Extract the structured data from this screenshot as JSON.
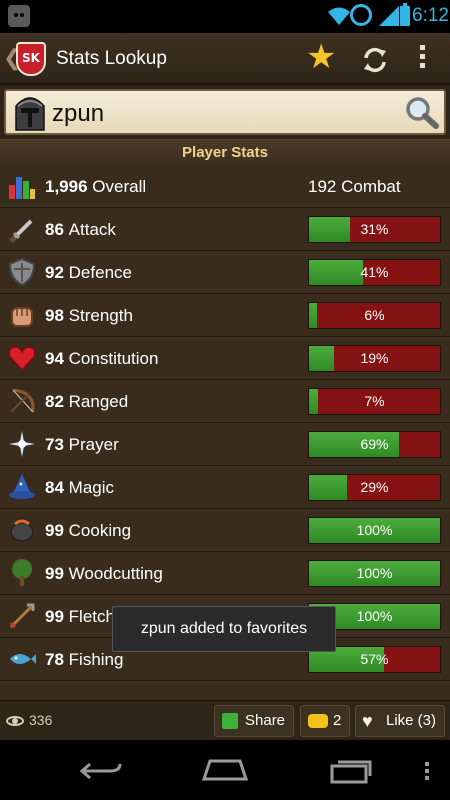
{
  "status_bar": {
    "time": "6:12"
  },
  "action_bar": {
    "back_glyph": "❮",
    "logo_text": "SK",
    "title": "Stats Lookup",
    "star_glyph": "★"
  },
  "search": {
    "value": "zpun"
  },
  "section": {
    "title": "Player Stats"
  },
  "overall": {
    "level": "1,996",
    "name": "Overall",
    "combat": "192 Combat"
  },
  "skills": [
    {
      "level": "86",
      "name": "Attack",
      "percent": 31,
      "pct_label": "31%",
      "icon": "sword-icon"
    },
    {
      "level": "92",
      "name": "Defence",
      "percent": 41,
      "pct_label": "41%",
      "icon": "shield-icon"
    },
    {
      "level": "98",
      "name": "Strength",
      "percent": 6,
      "pct_label": "6%",
      "icon": "fist-icon"
    },
    {
      "level": "94",
      "name": "Constitution",
      "percent": 19,
      "pct_label": "19%",
      "icon": "heart-icon"
    },
    {
      "level": "82",
      "name": "Ranged",
      "percent": 7,
      "pct_label": "7%",
      "icon": "bow-icon"
    },
    {
      "level": "73",
      "name": "Prayer",
      "percent": 69,
      "pct_label": "69%",
      "icon": "star-burst-icon"
    },
    {
      "level": "84",
      "name": "Magic",
      "percent": 29,
      "pct_label": "29%",
      "icon": "wizard-hat-icon"
    },
    {
      "level": "99",
      "name": "Cooking",
      "percent": 100,
      "pct_label": "100%",
      "icon": "cooking-pot-icon"
    },
    {
      "level": "99",
      "name": "Woodcutting",
      "percent": 100,
      "pct_label": "100%",
      "icon": "tree-icon"
    },
    {
      "level": "99",
      "name": "Fletching",
      "percent": 100,
      "pct_label": "100%",
      "icon": "arrows-icon"
    },
    {
      "level": "78",
      "name": "Fishing",
      "percent": 57,
      "pct_label": "57%",
      "icon": "fish-icon"
    }
  ],
  "toast": {
    "message": "zpun added to favorites"
  },
  "bottom_bar": {
    "views": "336",
    "share_label": "Share",
    "comments": "2",
    "like_label": "Like (3)"
  },
  "colors": {
    "bar_fill": "#3f9c32",
    "bar_empty": "#861313",
    "header_text": "#f0d48c",
    "accent_status": "#33b5e5"
  }
}
